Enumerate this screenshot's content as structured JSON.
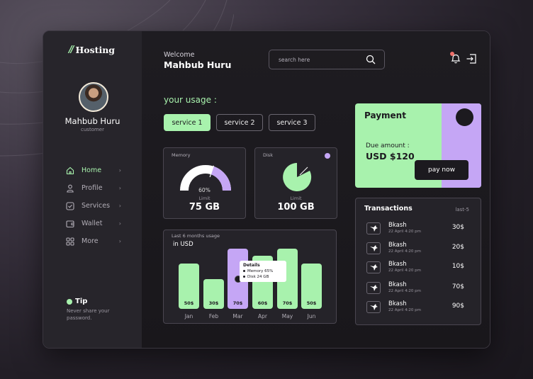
{
  "brand": {
    "name": "Hosting",
    "mark": "//"
  },
  "user": {
    "name": "Mahbub Huru",
    "role": "customer"
  },
  "nav": [
    {
      "label": "Home",
      "active": true,
      "icon": "home-icon"
    },
    {
      "label": "Profile",
      "active": false,
      "icon": "user-icon"
    },
    {
      "label": "Services",
      "active": false,
      "icon": "services-icon"
    },
    {
      "label": "Wallet",
      "active": false,
      "icon": "wallet-icon"
    },
    {
      "label": "More",
      "active": false,
      "icon": "grid-icon"
    }
  ],
  "nav_chevron": "›",
  "tip": {
    "title": "Tip",
    "text": "Never share your password."
  },
  "header": {
    "welcome": "Welcome",
    "name": "Mahbub Huru",
    "search_placeholder": "search here"
  },
  "usage": {
    "title": "your usage :",
    "services": [
      "service 1",
      "service 2",
      "service 3"
    ],
    "selected": 0
  },
  "memory": {
    "label": "Memory",
    "percent": 0.6,
    "percent_label": "60%",
    "limit_label": "Limit",
    "limit": "75 GB"
  },
  "disk": {
    "label": "Disk",
    "limit_label": "Limit",
    "limit": "100 GB"
  },
  "payment": {
    "title": "Payment",
    "due_label": "Due amount :",
    "amount": "USD $120",
    "button": "pay now"
  },
  "transactions": {
    "title": "Transactions",
    "filter": "last-5",
    "rows": [
      {
        "name": "Bkash",
        "date": "22 April 4:20 pm",
        "amount": "30$"
      },
      {
        "name": "Bkash",
        "date": "22 April 4:20 pm",
        "amount": "20$"
      },
      {
        "name": "Bkash",
        "date": "22 April 4:20 pm",
        "amount": "10$"
      },
      {
        "name": "Bkash",
        "date": "22 April 4:20 pm",
        "amount": "70$"
      },
      {
        "name": "Bkash",
        "date": "22 April 4:20 pm",
        "amount": "90$"
      }
    ]
  },
  "usage_chart": {
    "title": "Last 6 months usage",
    "subtitle": "in USD",
    "tooltip": {
      "title": "Details",
      "items": [
        "Memory 65%",
        "Disk 24 GB"
      ]
    },
    "colors": {
      "bar": "#a8f2ad",
      "highlight": "#c5a6f5"
    }
  },
  "chart_data": {
    "type": "bar",
    "categories": [
      "Jan",
      "Feb",
      "Mar",
      "Apr",
      "May",
      "Jun"
    ],
    "values": [
      50,
      30,
      70,
      60,
      70,
      50
    ],
    "value_labels": [
      "50$",
      "30$",
      "70$",
      "60$",
      "70$",
      "50$"
    ],
    "highlight_index": 2,
    "title": "Last 6 months usage",
    "ylabel": "in USD",
    "ylim": [
      0,
      80
    ]
  }
}
